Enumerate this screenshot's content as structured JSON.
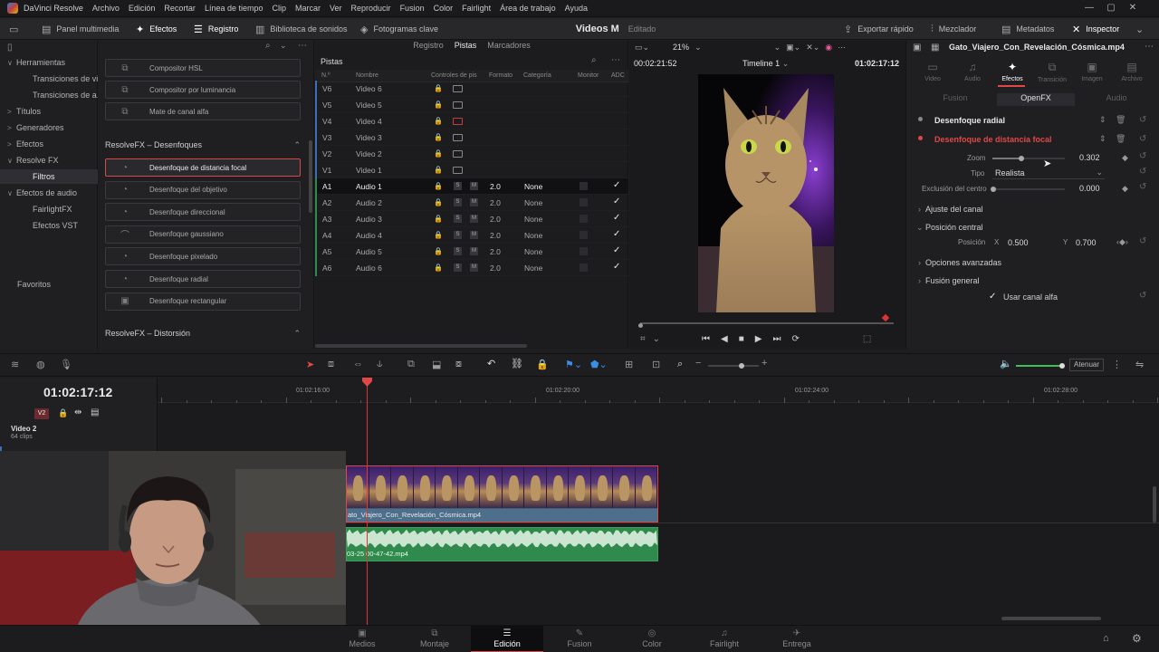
{
  "menubar": {
    "app_name": "DaVinci Resolve",
    "items": [
      "Archivo",
      "Edición",
      "Recortar",
      "Línea de tiempo",
      "Clip",
      "Marcar",
      "Ver",
      "Reproducir",
      "Fusion",
      "Color",
      "Fairlight",
      "Área de trabajo",
      "Ayuda"
    ]
  },
  "toolbar": {
    "media_pool": "Panel multimedia",
    "effects": "Efectos",
    "edit_index": "Registro",
    "sound_library": "Biblioteca de sonidos",
    "keyframes": "Fotogramas clave",
    "project_title": "Videos M",
    "project_status": "Editado",
    "quick_export": "Exportar rápido",
    "mixer": "Mezclador",
    "metadata": "Metadatos",
    "inspector": "Inspector"
  },
  "sidebar": {
    "items": [
      {
        "label": "Herramientas",
        "arrow": "∨"
      },
      {
        "label": "Transiciones de vi...",
        "arrow": ""
      },
      {
        "label": "Transiciones de a...",
        "arrow": ""
      },
      {
        "label": "Títulos",
        "arrow": ">"
      },
      {
        "label": "Generadores",
        "arrow": ">"
      },
      {
        "label": "Efectos",
        "arrow": ">"
      },
      {
        "label": "Resolve FX",
        "arrow": "∨"
      },
      {
        "label": "Filtros",
        "arrow": ""
      },
      {
        "label": "Efectos de audio",
        "arrow": "∨"
      },
      {
        "label": "FairlightFX",
        "arrow": ""
      },
      {
        "label": "Efectos VST",
        "arrow": ""
      }
    ],
    "favorites": "Favoritos"
  },
  "fxlist": {
    "top_cards": [
      "Compositor HSL",
      "Compositor por luminancia",
      "Mate de canal alfa"
    ],
    "section_blur": "ResolveFX – Desenfoques",
    "blur_cards": [
      "Desenfoque de distancia focal",
      "Desenfoque del objetivo",
      "Desenfoque direccional",
      "Desenfoque gaussiano",
      "Desenfoque pixelado",
      "Desenfoque radial",
      "Desenfoque rectangular"
    ],
    "section_distortion": "ResolveFX – Distorsión"
  },
  "tracks": {
    "tabs": [
      "Registro",
      "Pistas",
      "Marcadores"
    ],
    "title": "Pistas",
    "columns": [
      "N.º",
      "Nombre",
      "Controles de pis",
      "Formato",
      "Categoría",
      "Monitor",
      "ADC"
    ],
    "rows": [
      {
        "id": "V6",
        "name": "Video 6",
        "format": "",
        "category": "",
        "adc": false,
        "video": true
      },
      {
        "id": "V5",
        "name": "Video 5",
        "format": "",
        "category": "",
        "adc": false,
        "video": true
      },
      {
        "id": "V4",
        "name": "Video 4",
        "format": "",
        "category": "",
        "adc": false,
        "video": true,
        "red": true
      },
      {
        "id": "V3",
        "name": "Video 3",
        "format": "",
        "category": "",
        "adc": false,
        "video": true
      },
      {
        "id": "V2",
        "name": "Video 2",
        "format": "",
        "category": "",
        "adc": false,
        "video": true
      },
      {
        "id": "V1",
        "name": "Video 1",
        "format": "",
        "category": "",
        "adc": false,
        "video": true
      },
      {
        "id": "A1",
        "name": "Audio 1",
        "format": "2.0",
        "category": "None",
        "adc": true,
        "video": false,
        "sel": true
      },
      {
        "id": "A2",
        "name": "Audio 2",
        "format": "2.0",
        "category": "None",
        "adc": true,
        "video": false
      },
      {
        "id": "A3",
        "name": "Audio 3",
        "format": "2.0",
        "category": "None",
        "adc": true,
        "video": false
      },
      {
        "id": "A4",
        "name": "Audio 4",
        "format": "2.0",
        "category": "None",
        "adc": true,
        "video": false
      },
      {
        "id": "A5",
        "name": "Audio 5",
        "format": "2.0",
        "category": "None",
        "adc": true,
        "video": false
      },
      {
        "id": "A6",
        "name": "Audio 6",
        "format": "2.0",
        "category": "None",
        "adc": true,
        "video": false
      }
    ],
    "solo": "S",
    "mute": "M",
    "check": "✓"
  },
  "viewer": {
    "zoom": "21%",
    "source_tc": "00:02:21:52",
    "timeline_name": "Timeline 1",
    "record_tc": "01:02:17:12"
  },
  "inspector": {
    "filename": "Gato_Viajero_Con_Revelación_Cósmica.mp4",
    "tabs": [
      "Video",
      "Audio",
      "Efectos",
      "Transición",
      "Imagen",
      "Archivo"
    ],
    "active_tab": "Efectos",
    "subtabs": [
      "Fusion",
      "OpenFX",
      "Audio"
    ],
    "fx1": "Desenfoque radial",
    "fx2": "Desenfoque de distancia focal",
    "zoom_label": "Zoom",
    "zoom_value": "0.302",
    "zoom_fraction": 0.4,
    "type_label": "Tipo",
    "type_value": "Realista",
    "center_excl_label": "Exclusión del centro",
    "center_excl_value": "0.000",
    "channel_adjust": "Ajuste del canal",
    "central_pos": "Posición central",
    "position_label": "Posición",
    "pos_x_label": "X",
    "pos_x": "0.500",
    "pos_y_label": "Y",
    "pos_y": "0.700",
    "advanced": "Opciones avanzadas",
    "general_blend": "Fusión general",
    "use_alpha": "Usar canal alfa"
  },
  "timeline": {
    "timecode": "01:02:17:12",
    "mute_button": "Atenuar",
    "track_badge": "V2",
    "track_name": "Video 2",
    "track_clips": "64 clips",
    "ruler": [
      "01:02:16:00",
      "01:02:20:00",
      "01:02:24:00",
      "01:02:28:00"
    ],
    "video_clip": "Gato_Viajero_Con_Revelación_Cósmica.mp4",
    "video_clip_visible": "ato_Viajero_Con_Revelación_Cósmica.mp4",
    "audio_clip_visible": "03-25 00-47-42.mp4"
  },
  "pages": [
    {
      "label": "Medios",
      "glyph": "▣"
    },
    {
      "label": "Montaje",
      "glyph": "⧉"
    },
    {
      "label": "Edición",
      "glyph": "☰",
      "on": true
    },
    {
      "label": "Fusion",
      "glyph": "✎"
    },
    {
      "label": "Color",
      "glyph": "◎"
    },
    {
      "label": "Fairlight",
      "glyph": "♫"
    },
    {
      "label": "Entrega",
      "glyph": "✈"
    }
  ],
  "colors": {
    "accent_red": "#e04848",
    "video_clip": "#4d6f8c",
    "audio_clip": "#2f8a4d",
    "volume_green": "#3fbf5a"
  }
}
